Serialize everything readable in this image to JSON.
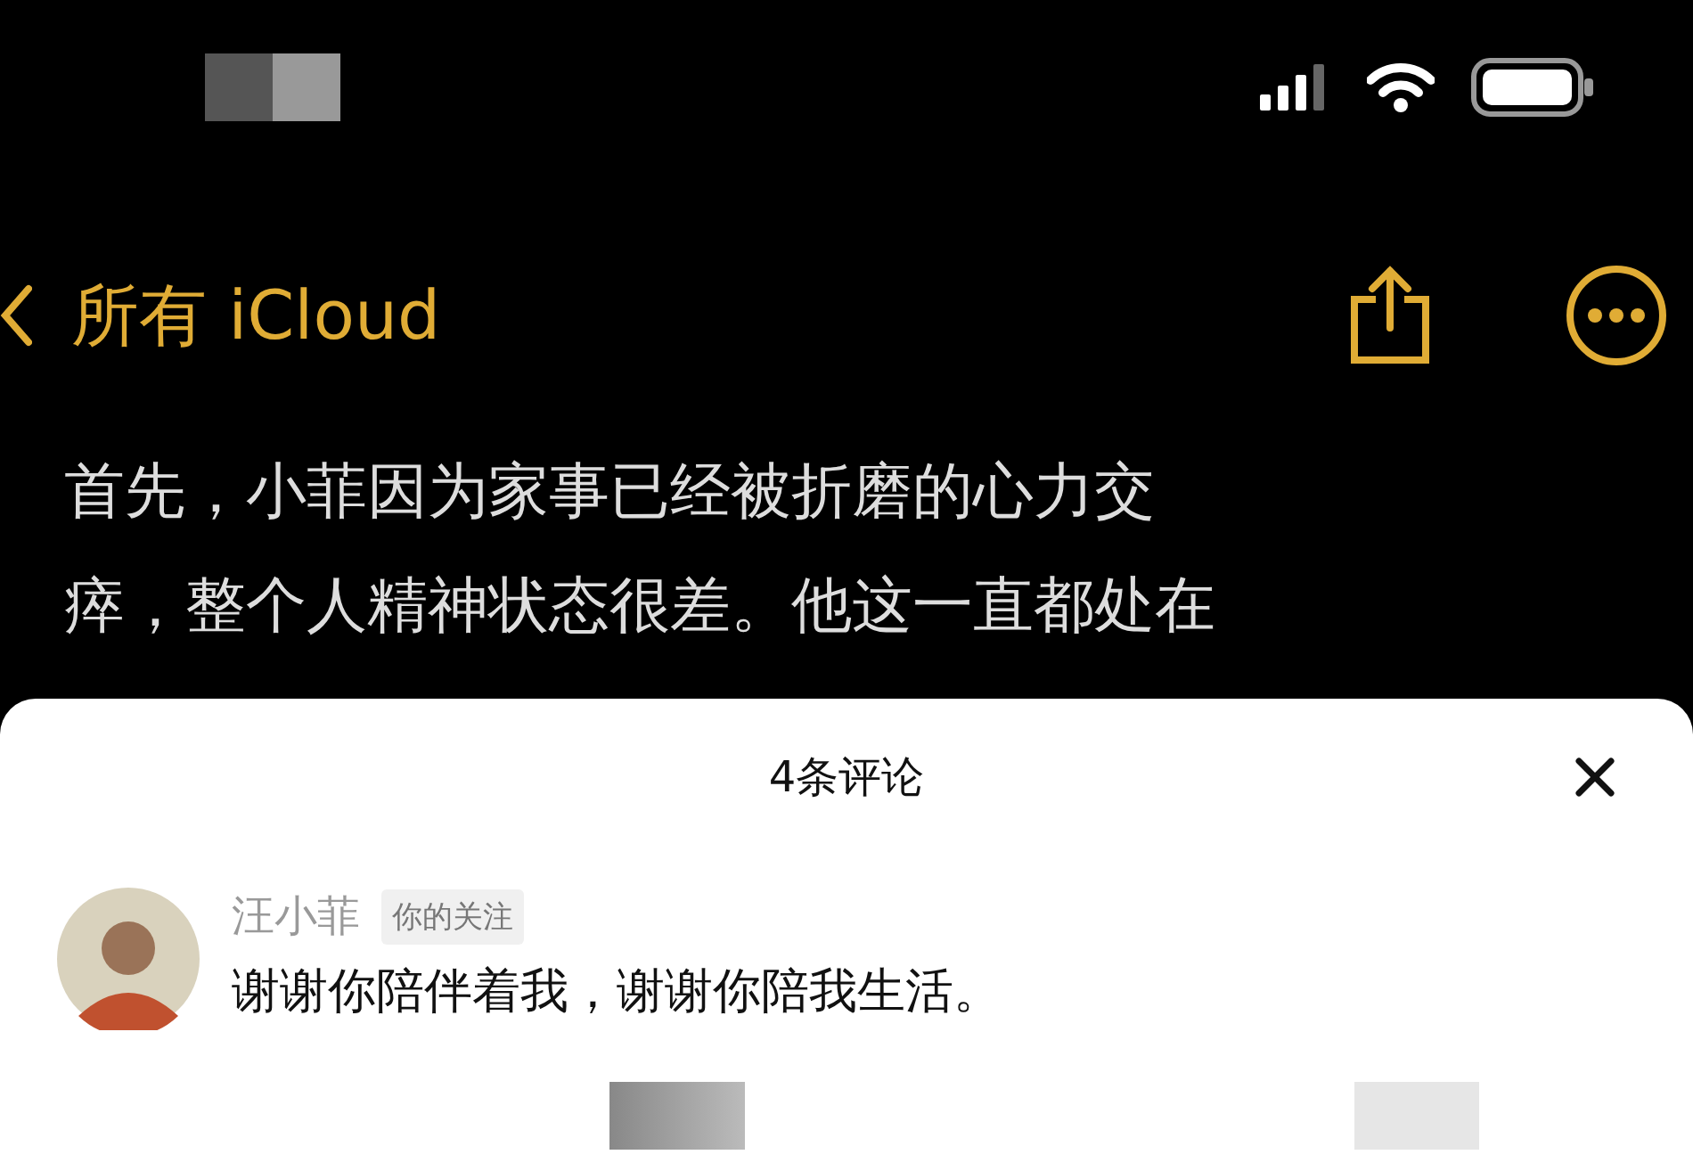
{
  "nav": {
    "back_label": "所有 iCloud"
  },
  "note": {
    "lines": [
      "首先，小菲因为家事已经被折磨的心力交",
      "瘁，整个人精神状态很差。他这一直都处在"
    ]
  },
  "comments_sheet": {
    "title": "4条评论",
    "comments": [
      {
        "author": "汪小菲",
        "tag": "你的关注",
        "text": "谢谢你陪伴着我，谢谢你陪我生活。"
      }
    ]
  }
}
